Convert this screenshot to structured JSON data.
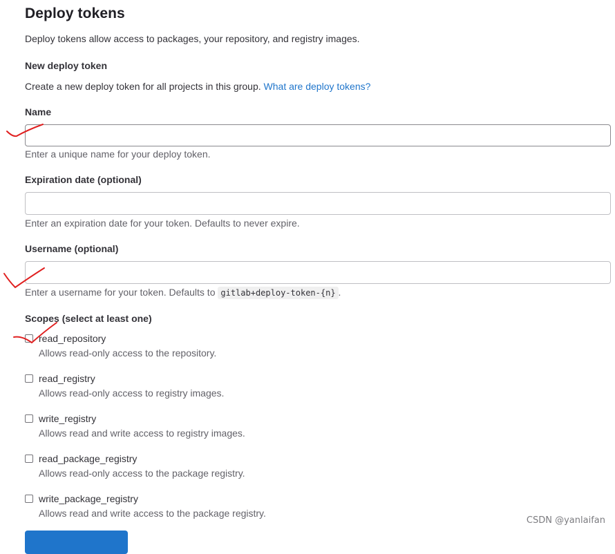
{
  "page": {
    "title": "Deploy tokens",
    "description": "Deploy tokens allow access to packages, your repository, and registry images."
  },
  "form": {
    "heading": "New deploy token",
    "intro": "Create a new deploy token for all projects in this group.",
    "intro_link": "What are deploy tokens?",
    "name": {
      "label": "Name",
      "value": "",
      "help": "Enter a unique name for your deploy token."
    },
    "expiration": {
      "label": "Expiration date (optional)",
      "value": "",
      "help": "Enter an expiration date for your token. Defaults to never expire."
    },
    "username": {
      "label": "Username (optional)",
      "value": "",
      "help_prefix": "Enter a username for your token. Defaults to",
      "help_code": "gitlab+deploy-token-{n}",
      "help_suffix": "."
    },
    "scopes": {
      "label": "Scopes (select at least one)",
      "items": [
        {
          "name": "read_repository",
          "help": "Allows read-only access to the repository.",
          "checked": false
        },
        {
          "name": "read_registry",
          "help": "Allows read-only access to registry images.",
          "checked": false
        },
        {
          "name": "write_registry",
          "help": "Allows read and write access to registry images.",
          "checked": false
        },
        {
          "name": "read_package_registry",
          "help": "Allows read-only access to the package registry.",
          "checked": false
        },
        {
          "name": "write_package_registry",
          "help": "Allows read and write access to the package registry.",
          "checked": false
        }
      ]
    }
  },
  "watermark": "CSDN @yanlaifan",
  "colors": {
    "link": "#1f75cb",
    "annotation": "#e02020"
  }
}
